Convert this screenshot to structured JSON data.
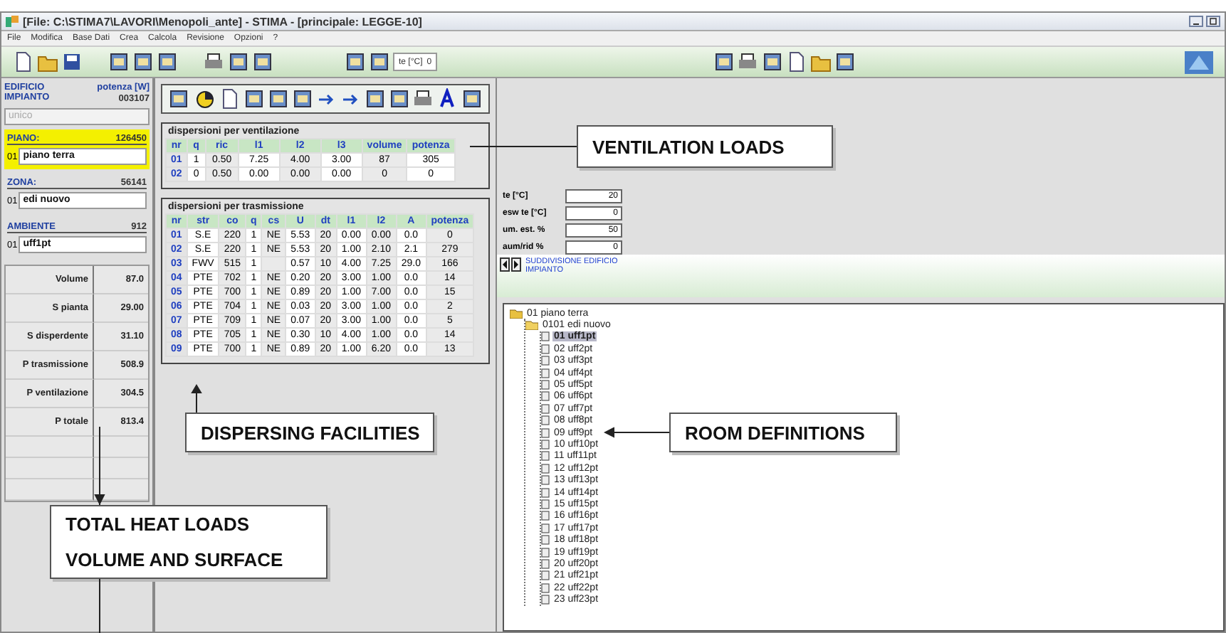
{
  "window": {
    "title": "[File: C:\\STIMA7\\LAVORI\\Menopoli_ante] - STIMA - [principale: LEGGE-10]"
  },
  "menu": [
    "File",
    "Modifica",
    "Base Dati",
    "Crea",
    "Calcola",
    "Revisione",
    "Opzioni",
    "?"
  ],
  "toolbar": {
    "field_label": "te [°C]",
    "field_value": "0"
  },
  "left_panel": {
    "building_label": "EDIFICIO\nIMPIANTO",
    "power_label": "potenza [W]",
    "power_value": "003107",
    "plant": {
      "value": "unico",
      "disabled": true
    },
    "levels": [
      {
        "label": "PIANO:",
        "value": "126450",
        "code": "01",
        "name": "piano terra",
        "highlighted": true
      },
      {
        "label": "ZONA:",
        "value": "56141",
        "code": "01",
        "name": "edi nuovo",
        "highlighted": false
      },
      {
        "label": "AMBIENTE",
        "value": "912",
        "code": "01",
        "name": "uff1pt",
        "highlighted": false
      }
    ],
    "totals": [
      {
        "label": "Volume",
        "value": "87.0"
      },
      {
        "label": "S pianta",
        "value": "29.00"
      },
      {
        "label": "S disperdente",
        "value": "31.10"
      },
      {
        "label": "P trasmissione",
        "value": "508.9"
      },
      {
        "label": "P ventilazione",
        "value": "304.5"
      },
      {
        "label": "P totale",
        "value": "813.4"
      }
    ]
  },
  "ventilation": {
    "title": "dispersioni per ventilazione",
    "columns": [
      "nr",
      "q",
      "ric",
      "l1",
      "l2",
      "l3",
      "volume",
      "potenza"
    ],
    "rows": [
      [
        "01",
        "1",
        "0.50",
        "7.25",
        "4.00",
        "3.00",
        "87",
        "305"
      ],
      [
        "02",
        "0",
        "0.50",
        "0.00",
        "0.00",
        "0.00",
        "0",
        "0"
      ]
    ]
  },
  "transmission": {
    "title": "dispersioni per trasmissione",
    "columns": [
      "nr",
      "str",
      "co",
      "q",
      "cs",
      "U",
      "dt",
      "l1",
      "l2",
      "A",
      "potenza"
    ],
    "rows": [
      [
        "01",
        "S.E",
        "220",
        "1",
        "NE",
        "5.53",
        "20",
        "0.00",
        "0.00",
        "0.0",
        "0"
      ],
      [
        "02",
        "S.E",
        "220",
        "1",
        "NE",
        "5.53",
        "20",
        "1.00",
        "2.10",
        "2.1",
        "279"
      ],
      [
        "03",
        "FWV",
        "515",
        "1",
        "",
        "0.57",
        "10",
        "4.00",
        "7.25",
        "29.0",
        "166"
      ],
      [
        "04",
        "PTE",
        "702",
        "1",
        "NE",
        "0.20",
        "20",
        "3.00",
        "1.00",
        "0.0",
        "14"
      ],
      [
        "05",
        "PTE",
        "700",
        "1",
        "NE",
        "0.89",
        "20",
        "1.00",
        "7.00",
        "0.0",
        "15"
      ],
      [
        "06",
        "PTE",
        "704",
        "1",
        "NE",
        "0.03",
        "20",
        "3.00",
        "1.00",
        "0.0",
        "2"
      ],
      [
        "07",
        "PTE",
        "709",
        "1",
        "NE",
        "0.07",
        "20",
        "3.00",
        "1.00",
        "0.0",
        "5"
      ],
      [
        "08",
        "PTE",
        "705",
        "1",
        "NE",
        "0.30",
        "10",
        "4.00",
        "1.00",
        "0.0",
        "14"
      ],
      [
        "09",
        "PTE",
        "700",
        "1",
        "NE",
        "0.89",
        "20",
        "1.00",
        "6.20",
        "0.0",
        "13"
      ]
    ]
  },
  "conditions": [
    {
      "label": "te [°C]",
      "value": "20"
    },
    {
      "label": "esw te [°C]",
      "value": "0"
    },
    {
      "label": "um. est. %",
      "value": "50"
    },
    {
      "label": "aum/rid %",
      "value": "0"
    }
  ],
  "subdivision": {
    "title": "SUDDIVISIONE EDIFICIO\nIMPIANTO"
  },
  "tree": [
    {
      "kind": "floor",
      "label": "01 piano terra",
      "selected": false,
      "children": [
        {
          "kind": "zone",
          "label": "0101 edi nuovo",
          "selected": false,
          "children": [
            {
              "kind": "room",
              "label": "01 uff1pt",
              "selected": true
            },
            {
              "kind": "room",
              "label": "02 uff2pt",
              "selected": false
            },
            {
              "kind": "room",
              "label": "03 uff3pt",
              "selected": false
            },
            {
              "kind": "room",
              "label": "04 uff4pt",
              "selected": false
            },
            {
              "kind": "room",
              "label": "05 uff5pt",
              "selected": false
            },
            {
              "kind": "room",
              "label": "06 uff6pt",
              "selected": false
            },
            {
              "kind": "room",
              "label": "07 uff7pt",
              "selected": false
            },
            {
              "kind": "room",
              "label": "08 uff8pt",
              "selected": false
            },
            {
              "kind": "room",
              "label": "09 uff9pt",
              "selected": false
            },
            {
              "kind": "room",
              "label": "10 uff10pt",
              "selected": false
            },
            {
              "kind": "room",
              "label": "11 uff11pt",
              "selected": false
            },
            {
              "kind": "room",
              "label": "12 uff12pt",
              "selected": false
            },
            {
              "kind": "room",
              "label": "13 uff13pt",
              "selected": false
            },
            {
              "kind": "room",
              "label": "14 uff14pt",
              "selected": false
            },
            {
              "kind": "room",
              "label": "15 uff15pt",
              "selected": false
            },
            {
              "kind": "room",
              "label": "16 uff16pt",
              "selected": false
            },
            {
              "kind": "room",
              "label": "17 uff17pt",
              "selected": false
            },
            {
              "kind": "room",
              "label": "18 uff18pt",
              "selected": false
            },
            {
              "kind": "room",
              "label": "19 uff19pt",
              "selected": false
            },
            {
              "kind": "room",
              "label": "20 uff20pt",
              "selected": false
            },
            {
              "kind": "room",
              "label": "21 uff21pt",
              "selected": false
            },
            {
              "kind": "room",
              "label": "22 uff22pt",
              "selected": false
            },
            {
              "kind": "room",
              "label": "23 uff23pt",
              "selected": false
            }
          ]
        }
      ]
    }
  ],
  "callouts": [
    {
      "kind": "ventilation",
      "lines": [
        "VENTILATION LOADS"
      ]
    },
    {
      "kind": "dispersing",
      "lines": [
        "DISPERSING FACILITIES"
      ]
    },
    {
      "kind": "totals",
      "lines": [
        "TOTAL HEAT LOADS",
        "VOLUME AND SURFACE"
      ]
    },
    {
      "kind": "rooms",
      "lines": [
        "ROOM DEFINITIONS"
      ]
    }
  ]
}
